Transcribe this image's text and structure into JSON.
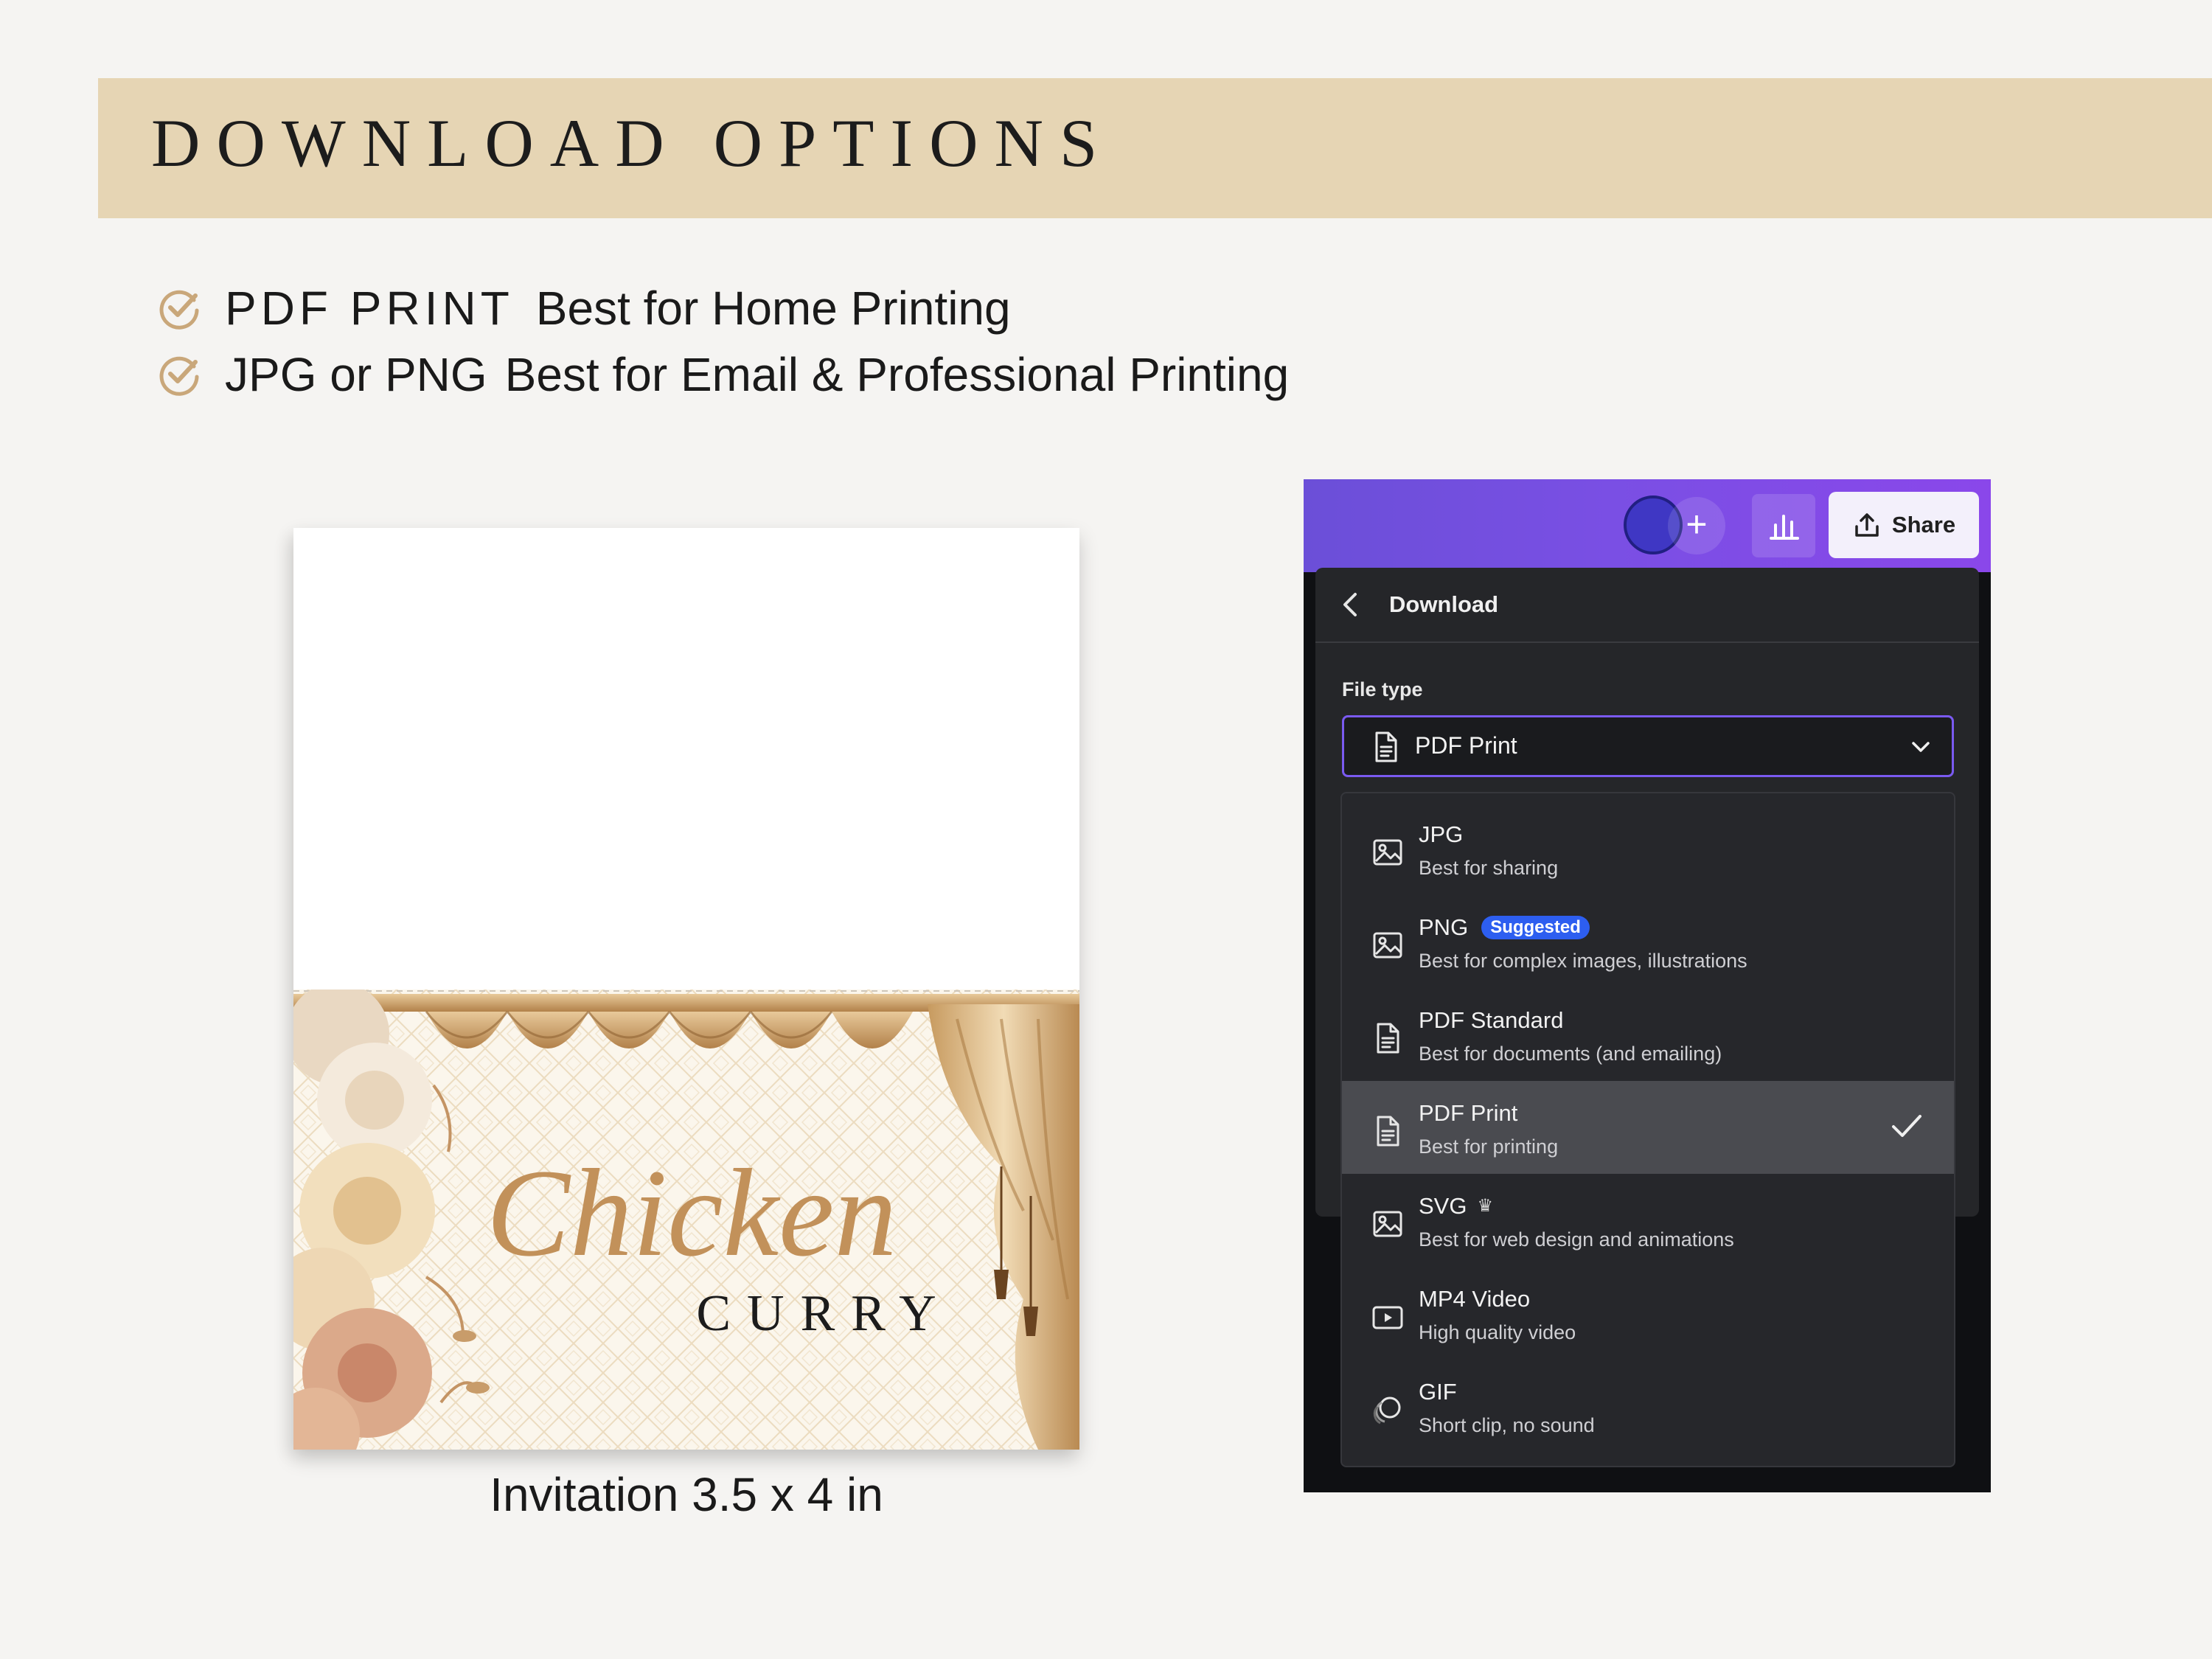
{
  "header": {
    "title": "DOWNLOAD OPTIONS"
  },
  "features": [
    {
      "label": "PDF PRINT",
      "description": "Best for Home Printing"
    },
    {
      "label": "JPG or PNG",
      "description": "Best for Email & Professional Printing"
    }
  ],
  "card": {
    "script_title": "Chicken",
    "subtitle": "CURRY",
    "caption_bold": "Invitation",
    "caption_size": "3.5 x 4 in"
  },
  "editor": {
    "topbar": {
      "plus": "+",
      "share_label": "Share"
    },
    "download": {
      "title": "Download",
      "file_type_label": "File type",
      "selected": "PDF Print",
      "options": [
        {
          "name": "JPG",
          "description": "Best for sharing",
          "icon": "image-icon"
        },
        {
          "name": "PNG",
          "badge": "Suggested",
          "description": "Best for complex images, illustrations",
          "icon": "image-icon"
        },
        {
          "name": "PDF Standard",
          "description": "Best for documents (and emailing)",
          "icon": "document-icon"
        },
        {
          "name": "PDF Print",
          "description": "Best for printing",
          "icon": "document-icon",
          "selected": true
        },
        {
          "name": "SVG",
          "crown": "♛",
          "description": "Best for web design and animations",
          "icon": "image-icon"
        },
        {
          "name": "MP4 Video",
          "description": "High quality video",
          "icon": "video-icon"
        },
        {
          "name": "GIF",
          "description": "Short clip, no sound",
          "icon": "gif-icon"
        }
      ]
    }
  },
  "colors": {
    "banner": "#e6d5b4",
    "accent_gold": "#c7975f",
    "topbar_purple": "#7a4fe4",
    "select_border": "#7a5af0",
    "badge_blue": "#2d5ef0"
  }
}
